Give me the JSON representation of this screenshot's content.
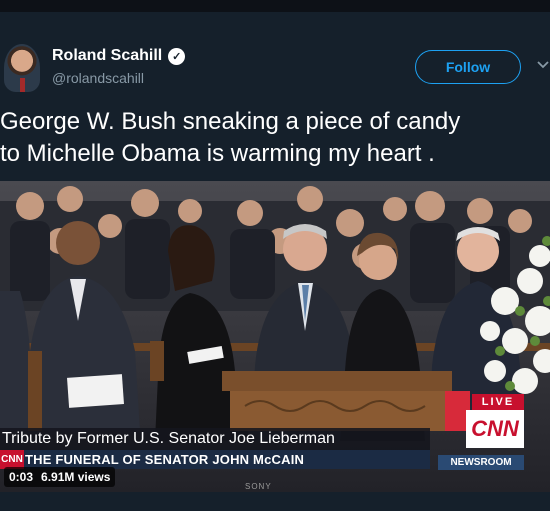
{
  "author": {
    "display_name": "Roland Scahill",
    "handle": "@rolandscahill",
    "verified_icon": "verified-check-icon"
  },
  "actions": {
    "follow_label": "Follow",
    "more_icon": "chevron-down-icon"
  },
  "tweet": {
    "text": "George W. Bush sneaking a piece of candy\nto Michelle Obama is warming my heart ."
  },
  "media": {
    "tribute_caption": "Tribute by Former U.S. Senator Joe Lieberman",
    "ticker_network": "CNN",
    "ticker_text": "THE FUNERAL OF SENATOR JOHN McCAIN",
    "live_label": "LIVE",
    "network_logo": "CNN",
    "newsroom_label": "NEWSROOM",
    "tv_brand": "SONY",
    "time": "0:03",
    "views": "6.91M views"
  },
  "colors": {
    "background": "#15202b",
    "accent": "#1da1f2",
    "secondary_text": "#8899a6",
    "cnn_red": "#c8102e"
  }
}
